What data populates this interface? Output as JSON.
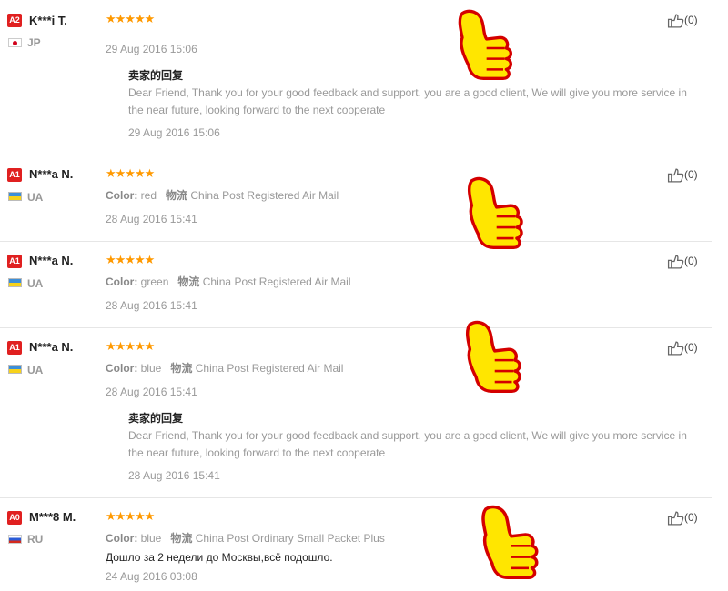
{
  "color_label": "Color:",
  "shipping_label": "物流",
  "reviews": [
    {
      "level": "A2",
      "name": "K***i T.",
      "flag": "jp",
      "country": "JP",
      "stars": "★★★★★",
      "date": "29 Aug 2016 15:06",
      "reply_title": "卖家的回复",
      "reply_text": "Dear Friend, Thank you for your good feedback and support. you are a good client, We will give you more service in the near future, looking forward to the next cooperate",
      "reply_date": "29 Aug 2016 15:06",
      "helpful": "(0)"
    },
    {
      "level": "A1",
      "name": "N***a N.",
      "flag": "ua",
      "country": "UA",
      "stars": "★★★★★",
      "color": "red",
      "shipping": "China Post Registered Air Mail",
      "date": "28 Aug 2016 15:41",
      "helpful": "(0)"
    },
    {
      "level": "A1",
      "name": "N***a N.",
      "flag": "ua",
      "country": "UA",
      "stars": "★★★★★",
      "color": "green",
      "shipping": "China Post Registered Air Mail",
      "date": "28 Aug 2016 15:41",
      "helpful": "(0)"
    },
    {
      "level": "A1",
      "name": "N***a N.",
      "flag": "ua",
      "country": "UA",
      "stars": "★★★★★",
      "color": "blue",
      "shipping": "China Post Registered Air Mail",
      "date": "28 Aug 2016 15:41",
      "reply_title": "卖家的回复",
      "reply_text": "Dear Friend, Thank you for your good feedback and support. you are a good client, We will give you more service in the near future, looking forward to the next cooperate",
      "reply_date": "28 Aug 2016 15:41",
      "helpful": "(0)"
    },
    {
      "level": "A0",
      "name": "M***8 M.",
      "flag": "ru",
      "country": "RU",
      "stars": "★★★★★",
      "color": "blue",
      "shipping": "China Post Ordinary Small Packet Plus",
      "feedback": "Дошло за 2 недели до Москвы,всё подошло.",
      "date": "24 Aug 2016 03:08",
      "helpful": "(0)"
    }
  ]
}
